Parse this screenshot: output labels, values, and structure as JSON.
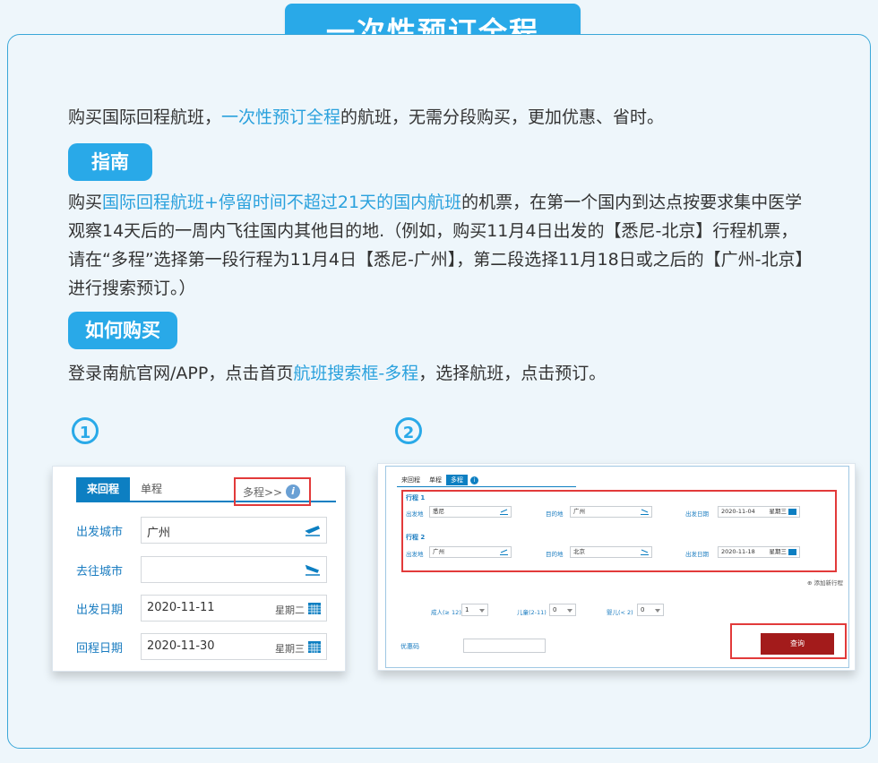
{
  "header": {
    "title": "一次性预订全程"
  },
  "intro": {
    "pre": "购买国际回程航班，",
    "highlight": "一次性预订全程",
    "post": "的航班，无需分段购买，更加优惠、省时。"
  },
  "guide": {
    "label": "指南",
    "pre": "购买",
    "highlight": "国际回程航班+停留时间不超过21天的国内航班",
    "post": "的机票，在第一个国内到达点按要求集中医学观察14天后的一周内飞往国内其他目的地.（例如，购买11月4日出发的【悉尼-北京】行程机票，请在“多程”选择第一段行程为11月4日【悉尼-广州】，第二段选择11月18日或之后的【广州-北京】进行搜索预订。）"
  },
  "howto": {
    "label": "如何购买",
    "pre": "登录南航官网/APP，点击首页",
    "highlight": "航班搜索框-多程",
    "post": "，选择航班，点击预订。"
  },
  "steps": {
    "one": "①",
    "two": "②"
  },
  "shot1": {
    "tabs": [
      "来回程",
      "单程"
    ],
    "multi": "多程>>",
    "info": "i",
    "rows": [
      {
        "label": "出发城市",
        "value": "广州",
        "icon": "plane-takeoff-icon"
      },
      {
        "label": "去往城市",
        "value": "",
        "icon": "plane-landing-icon"
      },
      {
        "label": "出发日期",
        "value": "2020-11-11",
        "weekday": "星期二",
        "icon": "calendar-icon"
      },
      {
        "label": "回程日期",
        "value": "2020-11-30",
        "weekday": "星期三",
        "icon": "calendar-icon"
      }
    ]
  },
  "shot2": {
    "tabs": [
      "来回程",
      "单程",
      "多程"
    ],
    "info": "i",
    "segments": [
      {
        "title": "行程 1",
        "from_label": "出发地",
        "from": "悉尼",
        "to_label": "目的地",
        "to": "广州",
        "date_label": "出发日期",
        "date": "2020-11-04",
        "weekday": "星期三"
      },
      {
        "title": "行程 2",
        "from_label": "出发地",
        "from": "广州",
        "to_label": "目的地",
        "to": "北京",
        "date_label": "出发日期",
        "date": "2020-11-18",
        "weekday": "星期三"
      }
    ],
    "add_trip": "⊕ 添加新行程",
    "adult_label": "成人(≥ 12)",
    "adult": "1",
    "child_label": "儿童(2-11)",
    "child": "0",
    "infant_label": "婴儿(< 2)",
    "infant": "0",
    "promo_label": "优惠码",
    "search": "查询"
  },
  "colors": {
    "accent": "#29a9e8",
    "link": "#2aa1dd",
    "highlight_box": "#e23a3a",
    "search_button": "#a31b1b"
  }
}
